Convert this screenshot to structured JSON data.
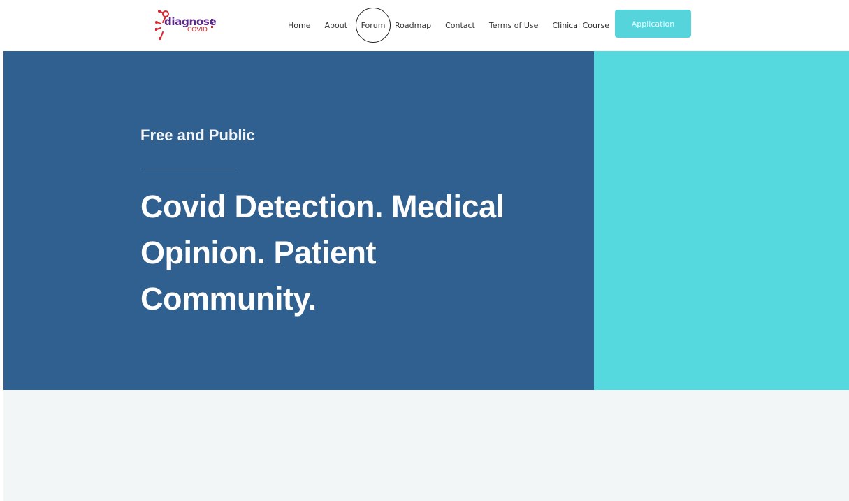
{
  "header": {
    "logo": {
      "name": "diagnose",
      "sub": "COVID",
      "icon": "virus-icon"
    },
    "nav": [
      {
        "label": "Home"
      },
      {
        "label": "About"
      },
      {
        "label": "Forum"
      },
      {
        "label": "Roadmap"
      },
      {
        "label": "Contact"
      },
      {
        "label": "Terms of Use"
      },
      {
        "label": "Clinical Course"
      }
    ],
    "cta_label": "Application"
  },
  "hero": {
    "kicker": "Free and Public",
    "headline": "Covid Detection. Medical Opinion. Patient Community."
  },
  "colors": {
    "hero_left": "#306090",
    "hero_right": "#55d8de",
    "cta": "#55d4dc",
    "lower_bg": "#f3f6f7",
    "logo_purple": "#5b2a86",
    "logo_red": "#d6262f"
  }
}
